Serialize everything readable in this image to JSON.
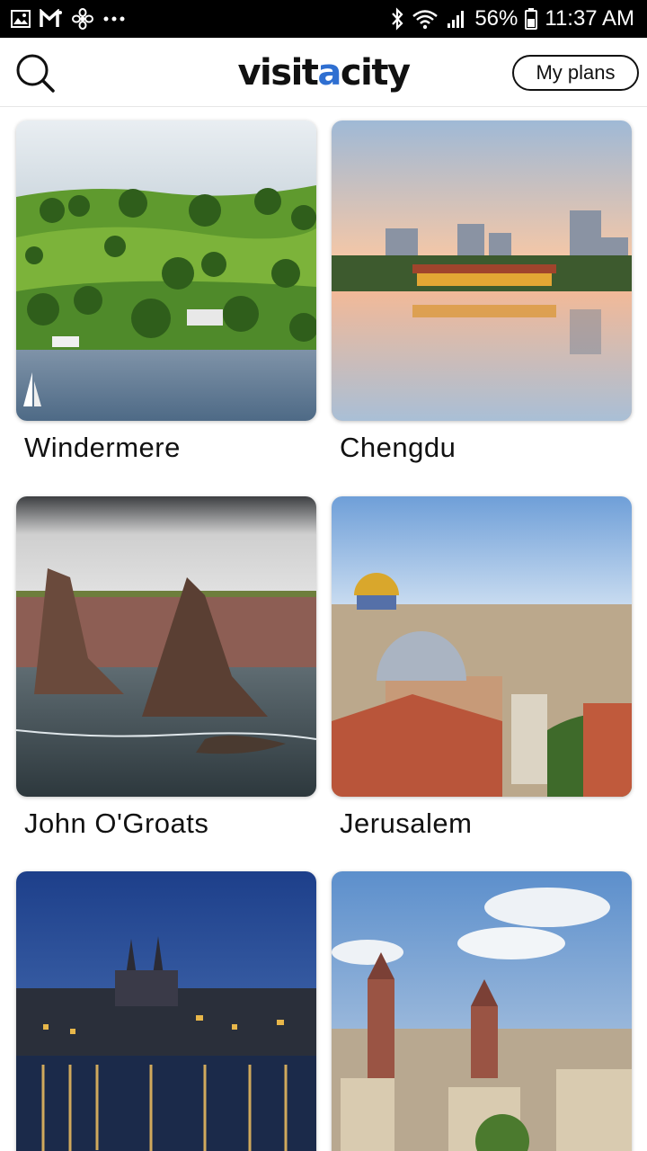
{
  "status_bar": {
    "battery": "56%",
    "time": "11:37 AM",
    "icons": [
      "gallery-icon",
      "gmail-icon",
      "fan-icon",
      "more-icon",
      "bluetooth-icon",
      "wifi-icon",
      "signal-icon",
      "battery-icon"
    ]
  },
  "header": {
    "logo_part1": "visit",
    "logo_accent": "a",
    "logo_part2": "city",
    "plans_label": "My plans",
    "search_icon": "search-icon"
  },
  "cities": [
    {
      "name": "Windermere"
    },
    {
      "name": "Chengdu"
    },
    {
      "name": "John O'Groats"
    },
    {
      "name": "Jerusalem"
    },
    {
      "name": ""
    },
    {
      "name": ""
    }
  ],
  "colors": {
    "accent": "#2f6fd1",
    "status_bar_bg": "#000000"
  }
}
